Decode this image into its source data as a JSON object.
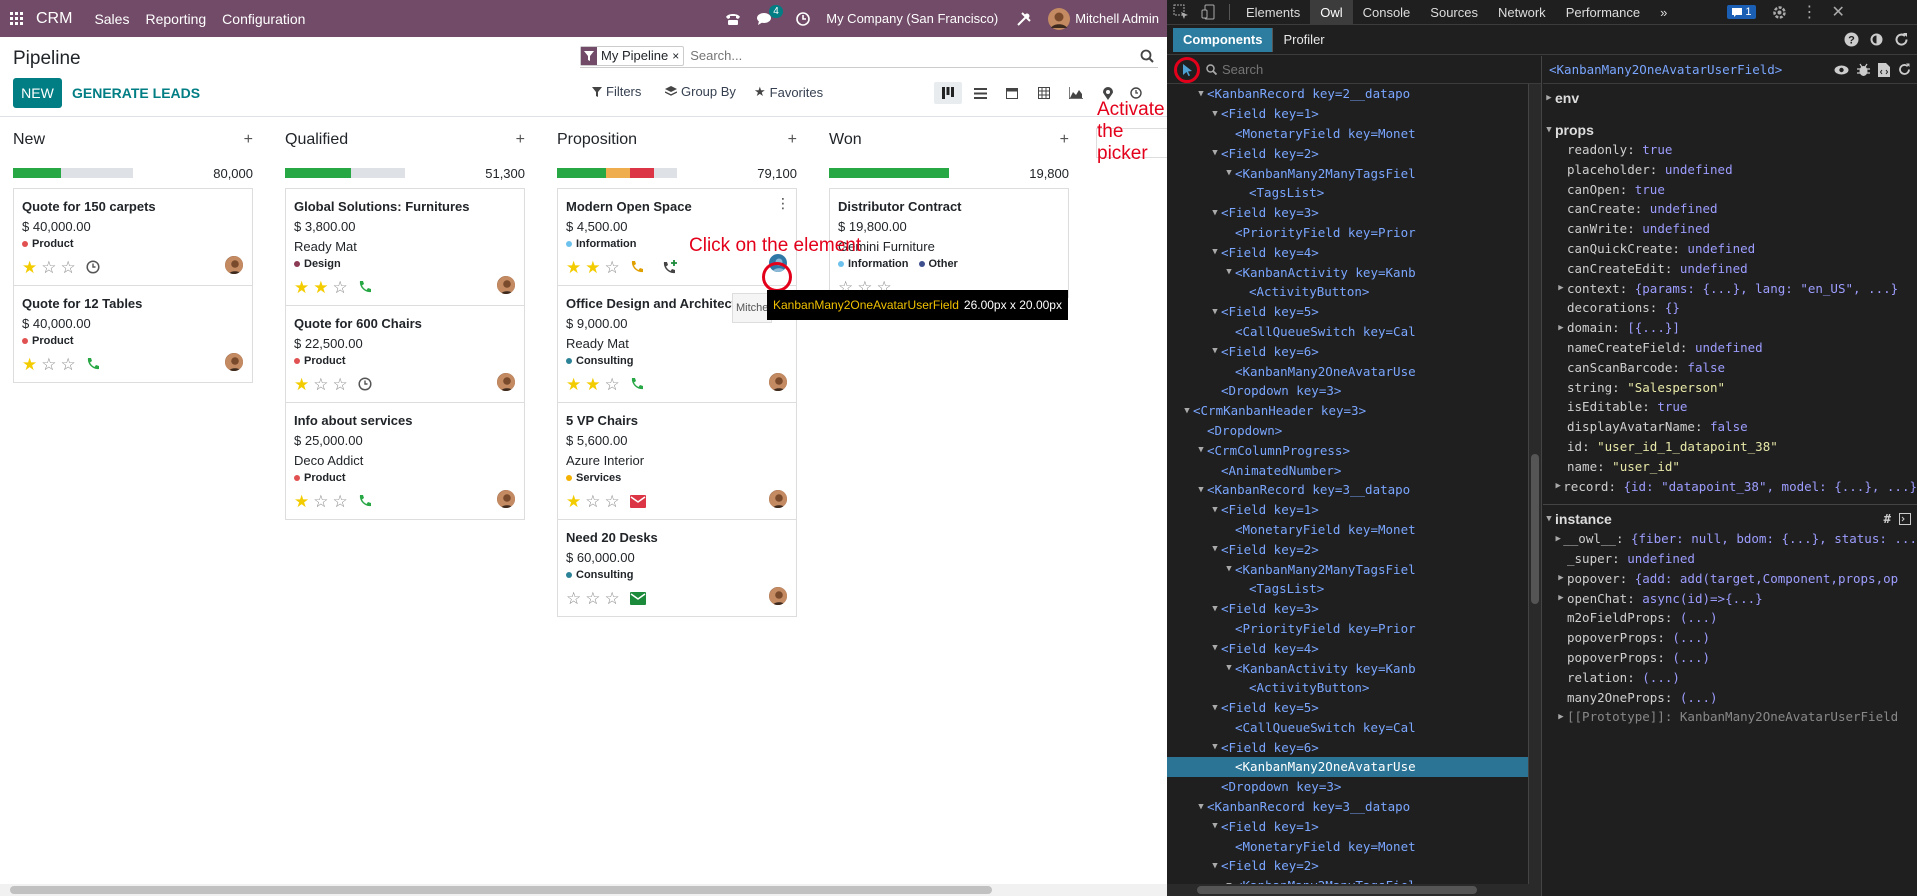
{
  "navbar": {
    "app": "CRM",
    "menus": [
      "Sales",
      "Reporting",
      "Configuration"
    ],
    "chat_count": "4",
    "company": "My Company (San Francisco)",
    "user": "Mitchell Admin"
  },
  "control_panel": {
    "title": "Pipeline",
    "new_label": "NEW",
    "generate_label": "GENERATE LEADS",
    "facet_label": "My Pipeline",
    "search_placeholder": "Search...",
    "filters_label": "Filters",
    "groupby_label": "Group By",
    "favorites_label": "Favorites"
  },
  "columns": [
    {
      "name": "New",
      "total": "80,000",
      "progress": [
        {
          "color": "#28a745",
          "pct": 40
        }
      ],
      "cards": [
        {
          "title": "Quote for 150 carpets",
          "amount": "$ 40,000.00",
          "partner": "",
          "tags": [
            {
              "label": "Product",
              "color": "#e25151"
            }
          ],
          "stars": 1,
          "activity": "clock"
        },
        {
          "title": "Quote for 12 Tables",
          "amount": "$ 40,000.00",
          "partner": "",
          "tags": [
            {
              "label": "Product",
              "color": "#e25151"
            }
          ],
          "stars": 1,
          "activity": "phone"
        }
      ]
    },
    {
      "name": "Qualified",
      "total": "51,300",
      "progress": [
        {
          "color": "#28a745",
          "pct": 55
        }
      ],
      "cards": [
        {
          "title": "Global Solutions: Furnitures",
          "amount": "$ 3,800.00",
          "partner": "Ready Mat",
          "tags": [
            {
              "label": "Design",
              "color": "#8c3b54"
            }
          ],
          "stars": 2,
          "activity": "phone"
        },
        {
          "title": "Quote for 600 Chairs",
          "amount": "$ 22,500.00",
          "partner": "",
          "tags": [
            {
              "label": "Product",
              "color": "#e25151"
            }
          ],
          "stars": 1,
          "activity": "clock"
        },
        {
          "title": "Info about services",
          "amount": "$ 25,000.00",
          "partner": "Deco Addict",
          "tags": [
            {
              "label": "Product",
              "color": "#e25151"
            }
          ],
          "stars": 1,
          "activity": "phone"
        }
      ]
    },
    {
      "name": "Proposition",
      "total": "79,100",
      "progress": [
        {
          "color": "#28a745",
          "pct": 41
        },
        {
          "color": "#f0ad4e",
          "pct": 20
        },
        {
          "color": "#dc3545",
          "pct": 20
        }
      ],
      "cards": [
        {
          "title": "Modern Open Space",
          "amount": "$ 4,500.00",
          "partner": "",
          "tags": [
            {
              "label": "Information",
              "color": "#6cc1ed"
            }
          ],
          "stars": 2,
          "activity": "phone-orange"
        },
        {
          "title": "Office Design and Architecture",
          "amount": "$ 9,000.00",
          "partner": "Ready Mat",
          "tags": [
            {
              "label": "Consulting",
              "color": "#2c8397"
            }
          ],
          "stars": 2,
          "activity": "phone"
        },
        {
          "title": "5 VP Chairs",
          "amount": "$ 5,600.00",
          "partner": "Azure Interior",
          "tags": [
            {
              "label": "Services",
              "color": "#f4b100"
            }
          ],
          "stars": 1,
          "activity": "mail-red"
        },
        {
          "title": "Need 20 Desks",
          "amount": "$ 60,000.00",
          "partner": "",
          "tags": [
            {
              "label": "Consulting",
              "color": "#2c8397"
            }
          ],
          "stars": 0,
          "activity": "mail-green"
        }
      ]
    },
    {
      "name": "Won",
      "total": "19,800",
      "progress": [
        {
          "color": "#28a745",
          "pct": 100
        }
      ],
      "cards": [
        {
          "title": "Distributor Contract",
          "amount": "$ 19,800.00",
          "partner": "Gemini Furniture",
          "tags": [
            {
              "label": "Information",
              "color": "#6cc1ed"
            },
            {
              "label": "Other",
              "color": "#3d4f8d"
            }
          ],
          "stars": 0,
          "activity": "none"
        }
      ]
    }
  ],
  "annotations": {
    "click_element": "Click on the element",
    "activate_picker": "Activate the picker",
    "tooltip_component": "KanbanMany2OneAvatarUserField",
    "tooltip_size": "26.00px x 20.00px",
    "tooltip_prefix": "Mitche"
  },
  "devtools": {
    "tabs": [
      "Elements",
      "Owl",
      "Console",
      "Sources",
      "Network",
      "Performance"
    ],
    "active_tab": "Owl",
    "msg_count": "1",
    "owl_tabs": [
      "Components",
      "Profiler"
    ],
    "search_placeholder": "Search",
    "selected_component": "<KanbanMany2OneAvatarUserField>",
    "tree": [
      {
        "indent": 0,
        "arrow": "down",
        "text": "<KanbanRecord key=2__datapo",
        "sel": false
      },
      {
        "indent": 1,
        "arrow": "down",
        "text": "<Field key=1>",
        "sel": false
      },
      {
        "indent": 2,
        "arrow": "",
        "text": "<MonetaryField key=Monet",
        "sel": false
      },
      {
        "indent": 1,
        "arrow": "down",
        "text": "<Field key=2>",
        "sel": false
      },
      {
        "indent": 2,
        "arrow": "down",
        "text": "<KanbanMany2ManyTagsFiel",
        "sel": false
      },
      {
        "indent": 3,
        "arrow": "",
        "text": "<TagsList>",
        "sel": false
      },
      {
        "indent": 1,
        "arrow": "down",
        "text": "<Field key=3>",
        "sel": false
      },
      {
        "indent": 2,
        "arrow": "",
        "text": "<PriorityField key=Prior",
        "sel": false
      },
      {
        "indent": 1,
        "arrow": "down",
        "text": "<Field key=4>",
        "sel": false
      },
      {
        "indent": 2,
        "arrow": "down",
        "text": "<KanbanActivity key=Kanb",
        "sel": false
      },
      {
        "indent": 3,
        "arrow": "",
        "text": "<ActivityButton>",
        "sel": false
      },
      {
        "indent": 1,
        "arrow": "down",
        "text": "<Field key=5>",
        "sel": false
      },
      {
        "indent": 2,
        "arrow": "",
        "text": "<CallQueueSwitch key=Cal",
        "sel": false
      },
      {
        "indent": 1,
        "arrow": "down",
        "text": "<Field key=6>",
        "sel": false
      },
      {
        "indent": 2,
        "arrow": "",
        "text": "<KanbanMany2OneAvatarUse",
        "sel": false
      },
      {
        "indent": 1,
        "arrow": "",
        "text": "<Dropdown key=3>",
        "sel": false
      },
      {
        "indent": -1,
        "arrow": "down",
        "text": "<CrmKanbanHeader key=3>",
        "sel": false
      },
      {
        "indent": 0,
        "arrow": "",
        "text": "<Dropdown>",
        "sel": false
      },
      {
        "indent": 0,
        "arrow": "down",
        "text": "<CrmColumnProgress>",
        "sel": false
      },
      {
        "indent": 1,
        "arrow": "",
        "text": "<AnimatedNumber>",
        "sel": false
      },
      {
        "indent": 0,
        "arrow": "down",
        "text": "<KanbanRecord key=3__datapo",
        "sel": false
      },
      {
        "indent": 1,
        "arrow": "down",
        "text": "<Field key=1>",
        "sel": false
      },
      {
        "indent": 2,
        "arrow": "",
        "text": "<MonetaryField key=Monet",
        "sel": false
      },
      {
        "indent": 1,
        "arrow": "down",
        "text": "<Field key=2>",
        "sel": false
      },
      {
        "indent": 2,
        "arrow": "down",
        "text": "<KanbanMany2ManyTagsFiel",
        "sel": false
      },
      {
        "indent": 3,
        "arrow": "",
        "text": "<TagsList>",
        "sel": false
      },
      {
        "indent": 1,
        "arrow": "down",
        "text": "<Field key=3>",
        "sel": false
      },
      {
        "indent": 2,
        "arrow": "",
        "text": "<PriorityField key=Prior",
        "sel": false
      },
      {
        "indent": 1,
        "arrow": "down",
        "text": "<Field key=4>",
        "sel": false
      },
      {
        "indent": 2,
        "arrow": "down",
        "text": "<KanbanActivity key=Kanb",
        "sel": false
      },
      {
        "indent": 3,
        "arrow": "",
        "text": "<ActivityButton>",
        "sel": false
      },
      {
        "indent": 1,
        "arrow": "down",
        "text": "<Field key=5>",
        "sel": false
      },
      {
        "indent": 2,
        "arrow": "",
        "text": "<CallQueueSwitch key=Cal",
        "sel": false
      },
      {
        "indent": 1,
        "arrow": "down",
        "text": "<Field key=6>",
        "sel": false
      },
      {
        "indent": 2,
        "arrow": "",
        "text": "<KanbanMany2OneAvatarUse",
        "sel": true
      },
      {
        "indent": 1,
        "arrow": "",
        "text": "<Dropdown key=3>",
        "sel": false
      },
      {
        "indent": 0,
        "arrow": "down",
        "text": "<KanbanRecord key=3__datapo",
        "sel": false
      },
      {
        "indent": 1,
        "arrow": "down",
        "text": "<Field key=1>",
        "sel": false
      },
      {
        "indent": 2,
        "arrow": "",
        "text": "<MonetaryField key=Monet",
        "sel": false
      },
      {
        "indent": 1,
        "arrow": "down",
        "text": "<Field key=2>",
        "sel": false
      },
      {
        "indent": 2,
        "arrow": "down",
        "text": "<KanbanMany2ManyTagsFiel",
        "sel": false
      }
    ],
    "env_label": "env",
    "props_label": "props",
    "props": [
      {
        "k": "readonly",
        "v": "true",
        "exp": false,
        "str": false
      },
      {
        "k": "placeholder",
        "v": "undefined",
        "exp": false,
        "str": false
      },
      {
        "k": "canOpen",
        "v": "true",
        "exp": false,
        "str": false
      },
      {
        "k": "canCreate",
        "v": "undefined",
        "exp": false,
        "str": false
      },
      {
        "k": "canWrite",
        "v": "undefined",
        "exp": false,
        "str": false
      },
      {
        "k": "canQuickCreate",
        "v": "undefined",
        "exp": false,
        "str": false
      },
      {
        "k": "canCreateEdit",
        "v": "undefined",
        "exp": false,
        "str": false
      },
      {
        "k": "context",
        "v": "{params: {...}, lang: \"en_US\", ...}",
        "exp": true,
        "str": false
      },
      {
        "k": "decorations",
        "v": "{}",
        "exp": false,
        "str": false
      },
      {
        "k": "domain",
        "v": "[{...}]",
        "exp": true,
        "str": false
      },
      {
        "k": "nameCreateField",
        "v": "undefined",
        "exp": false,
        "str": false
      },
      {
        "k": "canScanBarcode",
        "v": "false",
        "exp": false,
        "str": false
      },
      {
        "k": "string",
        "v": "\"Salesperson\"",
        "exp": false,
        "str": true
      },
      {
        "k": "isEditable",
        "v": "true",
        "exp": false,
        "str": false
      },
      {
        "k": "displayAvatarName",
        "v": "false",
        "exp": false,
        "str": false
      },
      {
        "k": "id",
        "v": "\"user_id_1_datapoint_38\"",
        "exp": false,
        "str": true
      },
      {
        "k": "name",
        "v": "\"user_id\"",
        "exp": false,
        "str": true
      },
      {
        "k": "record",
        "v": "{id: \"datapoint_38\", model: {...}, ...}",
        "exp": true,
        "str": false
      }
    ],
    "instance_label": "instance",
    "instance": [
      {
        "k": "__owl__",
        "v": "{fiber: null, bdom: {...}, status: ...",
        "exp": true
      },
      {
        "k": "_super",
        "v": "undefined",
        "exp": false
      },
      {
        "k": "popover",
        "v": "{add: add(target,Component,props,op",
        "exp": true
      },
      {
        "k": "openChat",
        "v": "async(id)=>{...}",
        "exp": true
      },
      {
        "k": "m2oFieldProps",
        "v": "(...)",
        "exp": false
      },
      {
        "k": "popoverProps",
        "v": "(...)",
        "exp": false
      },
      {
        "k": "popoverProps",
        "v": "(...)",
        "exp": false
      },
      {
        "k": "relation",
        "v": "(...)",
        "exp": false
      },
      {
        "k": "many2OneProps",
        "v": "(...)",
        "exp": false
      },
      {
        "k": "[[Prototype]]",
        "v": "KanbanMany2OneAvatarUserField",
        "exp": true
      }
    ]
  }
}
